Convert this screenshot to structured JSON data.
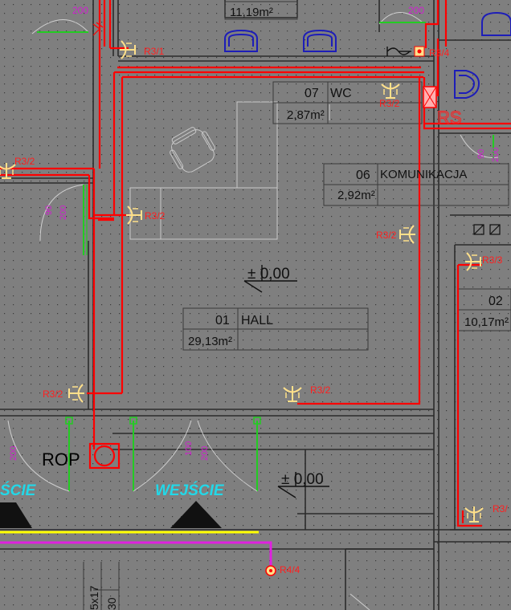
{
  "rooms": {
    "top_area": "11,19m²",
    "wc": {
      "number": "07",
      "name": "WC",
      "area": "2,87m²"
    },
    "komunikacja": {
      "number": "06",
      "name": "KOMUNIKACJA",
      "area": "2,92m²"
    },
    "hall": {
      "number": "01",
      "name": "HALL",
      "area": "29,13m²"
    },
    "room02": {
      "number": "02",
      "area": "10,17m²"
    }
  },
  "levels": {
    "hall": "± 0,00",
    "entrance": "± 0,00"
  },
  "entrance": {
    "left": "ŚCIE",
    "center": "WEJŚCIE"
  },
  "rop": "ROP",
  "sensors": {
    "r3_1": "R3/1",
    "r3_4": "R3/4",
    "r3_2": "R3/2",
    "r3_3": "R3/3",
    "r3_partial": "R3/",
    "r4_4": "R4/4"
  },
  "door_dims": {
    "d200": "200",
    "d90": "90",
    "d100": "100"
  },
  "misc": {
    "rs": "RS",
    "dim_5x17": "5x17",
    "dim_30": "30"
  },
  "colors": {
    "background": "#7f7f7f",
    "wall": "#2b2b2b",
    "grid_dot": "#3a3a3a",
    "cable": "#ff0000",
    "detector": "#ffe08a",
    "door": "#22cc22",
    "dimension_text": "#d020d0",
    "entrance_text": "#22d8e8",
    "yellow_line": "#ffff00",
    "magenta_line": "#e020e0",
    "fixture": "#1d1db8",
    "furniture": "#c8c8c8"
  }
}
